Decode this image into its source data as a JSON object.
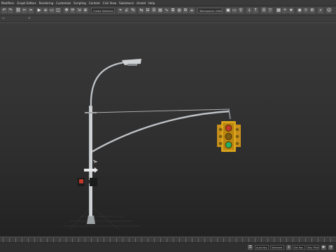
{
  "menu": [
    "Modifiers",
    "Graph Editors",
    "Rendering",
    "Customize",
    "Scripting",
    "Content",
    "Civil View",
    "Substance",
    "Arnold",
    "Help"
  ],
  "toolbar": {
    "selection_set_placeholder": "Create Selection Se...",
    "workspace": "Workspaces: Default"
  },
  "viewport": {
    "label": "[+] [Perspective] [Standard] [Default Shading]"
  },
  "status": {
    "auto_key_label": "Auto Key",
    "selected_label": "Selected",
    "set_key_label": "Set Key",
    "key_filters_label": "Key Filters...",
    "frame_field": "0 / 100"
  },
  "colors": {
    "signal_yellow": "#d9a21b",
    "red_lamp": "#c0392b",
    "green_lamp": "#27ae60",
    "pole": "#bfc3c6"
  }
}
